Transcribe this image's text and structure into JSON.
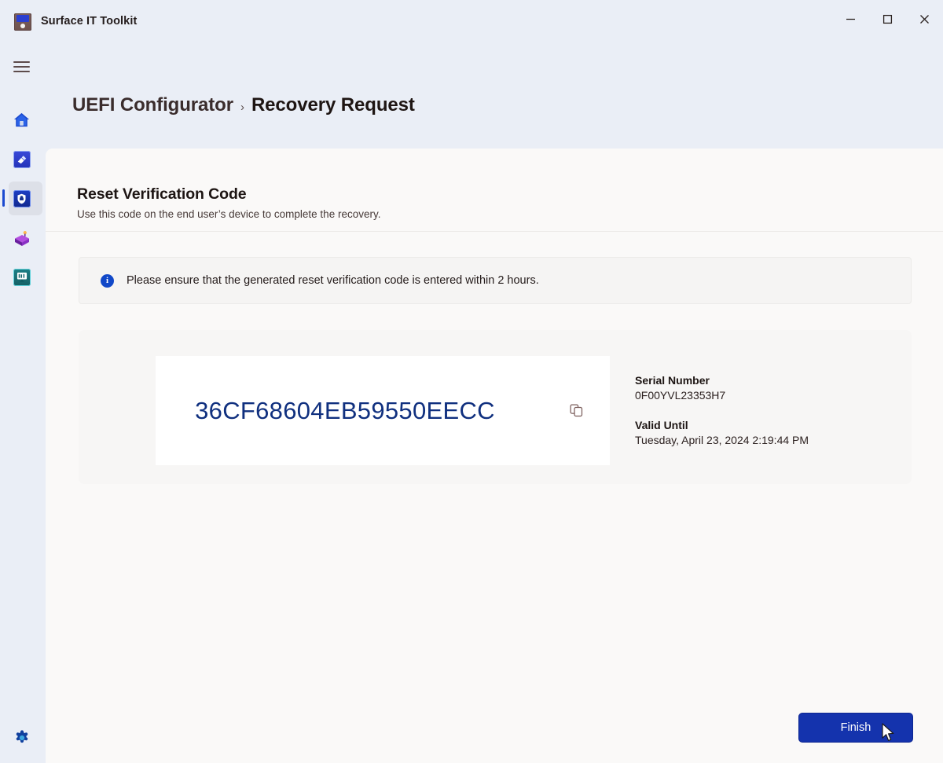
{
  "window": {
    "title": "Surface IT Toolkit",
    "app_icon": "toolkit-icon",
    "controls": {
      "minimize": "minimize-icon",
      "maximize": "maximize-icon",
      "close": "close-icon"
    }
  },
  "rail": {
    "menu_icon": "hamburger-menu-icon",
    "items": [
      {
        "icon": "home-icon",
        "label": "Home",
        "selected": false
      },
      {
        "icon": "data-eraser-icon",
        "label": "Data Eraser",
        "selected": false
      },
      {
        "icon": "uefi-configurator-shield-icon",
        "label": "UEFI Configurator",
        "selected": true
      },
      {
        "icon": "package-creator-icon",
        "label": "Package Creator",
        "selected": false
      },
      {
        "icon": "diagnostics-monitor-icon",
        "label": "Diagnostics",
        "selected": false
      }
    ],
    "settings_icon": "gear-icon"
  },
  "breadcrumb": {
    "parent": "UEFI Configurator",
    "separator": "›",
    "current": "Recovery Request"
  },
  "section": {
    "title": "Reset Verification Code",
    "subtitle": "Use this code on the end user’s device to complete the recovery."
  },
  "info": {
    "icon": "info-circle-icon",
    "glyph": "i",
    "message": "Please ensure that the generated reset verification code is entered within 2 hours."
  },
  "code_card": {
    "verification_code": "36CF68604EB59550EECC",
    "copy_icon": "copy-icon",
    "serial_number_label": "Serial Number",
    "serial_number_value": "0F00YVL23353H7",
    "valid_until_label": "Valid Until",
    "valid_until_value": "Tuesday, April 23, 2024 2:19:44 PM"
  },
  "footer": {
    "finish_label": "Finish"
  },
  "colors": {
    "window_background": "#eaeef6",
    "card_background": "#faf9f8",
    "code_card_background": "#f7f6f5",
    "code_panel_background": "#ffffff",
    "code_text": "#10307f",
    "accent_primary": "#1433ad",
    "info_icon": "#1148c8",
    "selection_indicator": "#1b4ad0",
    "text_primary": "#1d1513",
    "text_secondary": "#473a38"
  }
}
